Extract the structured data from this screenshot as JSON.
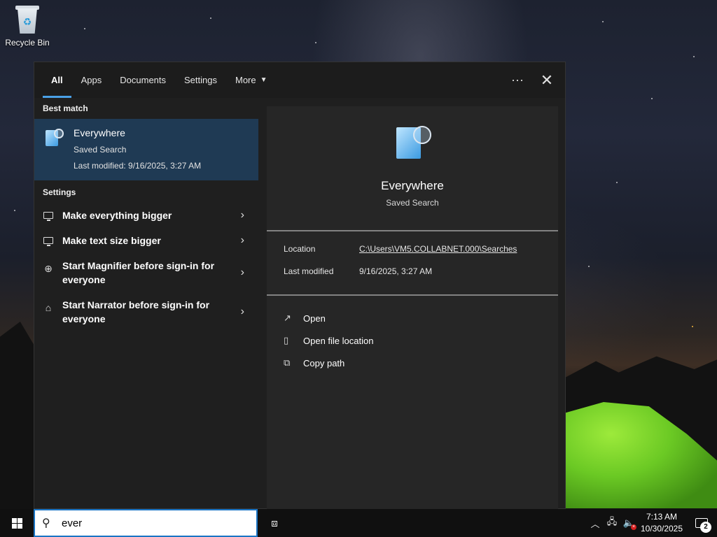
{
  "desktop": {
    "recycle_bin_label": "Recycle Bin"
  },
  "search": {
    "tabs": [
      {
        "label": "All",
        "active": true
      },
      {
        "label": "Apps"
      },
      {
        "label": "Documents"
      },
      {
        "label": "Settings"
      },
      {
        "label": "More"
      }
    ],
    "more_actions_label": "···",
    "close_label": "✕",
    "best_match": {
      "heading": "Best match",
      "title": "Everywhere",
      "type": "Saved Search",
      "modified": "Last modified: 9/16/2025, 3:27 AM",
      "icon": "saved-search-icon"
    },
    "settings": {
      "heading": "Settings",
      "items": [
        {
          "label": "Make everything bigger",
          "icon": "monitor-icon"
        },
        {
          "label": "Make text size bigger",
          "icon": "monitor-icon"
        },
        {
          "label": "Start Magnifier before sign-in for everyone",
          "icon": "magnifier-icon"
        },
        {
          "label": "Start Narrator before sign-in for everyone",
          "icon": "narrator-icon"
        }
      ]
    },
    "preview": {
      "name": "Everywhere",
      "type": "Saved Search",
      "location_label": "Location",
      "location_value": "C:\\Users\\VM5.COLLABNET.000\\Searches",
      "modified_label": "Last modified",
      "modified_value": "9/16/2025, 3:27 AM",
      "actions": [
        {
          "label": "Open",
          "icon": "open-icon"
        },
        {
          "label": "Open file location",
          "icon": "file-location-icon"
        },
        {
          "label": "Copy path",
          "icon": "copy-icon"
        }
      ]
    },
    "query": "ever"
  },
  "taskbar": {
    "time": "7:13 AM",
    "date": "10/30/2025",
    "notification_count": "2"
  },
  "colors": {
    "accent": "#4aa0e6",
    "selection": "#1f3a54",
    "panel": "#1f1f1f",
    "preview": "#262626",
    "search_border": "#1a74c4"
  }
}
